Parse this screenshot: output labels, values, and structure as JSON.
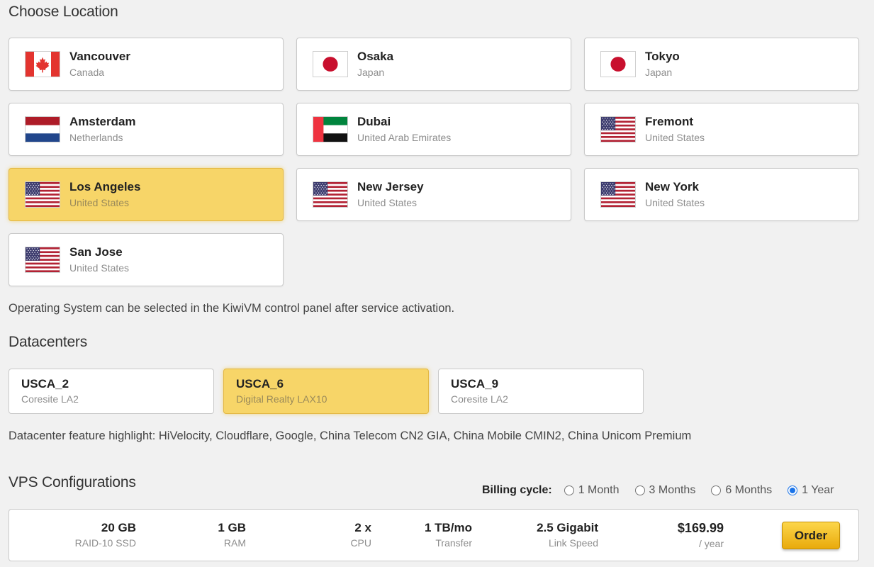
{
  "location": {
    "title": "Choose Location",
    "cards": [
      {
        "city": "Vancouver",
        "country": "Canada",
        "flag": "canada-flag"
      },
      {
        "city": "Osaka",
        "country": "Japan",
        "flag": "japan-flag"
      },
      {
        "city": "Tokyo",
        "country": "Japan",
        "flag": "japan-flag"
      },
      {
        "city": "Amsterdam",
        "country": "Netherlands",
        "flag": "netherlands-flag"
      },
      {
        "city": "Dubai",
        "country": "United Arab Emirates",
        "flag": "uae-flag"
      },
      {
        "city": "Fremont",
        "country": "United States",
        "flag": "us-flag"
      },
      {
        "city": "Los Angeles",
        "country": "United States",
        "flag": "us-flag",
        "selected": true
      },
      {
        "city": "New Jersey",
        "country": "United States",
        "flag": "us-flag"
      },
      {
        "city": "New York",
        "country": "United States",
        "flag": "us-flag"
      },
      {
        "city": "San Jose",
        "country": "United States",
        "flag": "us-flag"
      }
    ],
    "os_note": "Operating System can be selected in the KiwiVM control panel after service activation."
  },
  "datacenters": {
    "title": "Datacenters",
    "cards": [
      {
        "code": "USCA_2",
        "name": "Coresite LA2"
      },
      {
        "code": "USCA_6",
        "name": "Digital Realty LAX10",
        "selected": true
      },
      {
        "code": "USCA_9",
        "name": "Coresite LA2"
      }
    ],
    "feature_note": "Datacenter feature highlight: HiVelocity, Cloudflare, Google, China Telecom CN2 GIA, China Mobile CMIN2, China Unicom Premium"
  },
  "vps": {
    "title": "VPS Configurations",
    "billing": {
      "label": "Billing cycle:",
      "options": [
        "1 Month",
        "3 Months",
        "6 Months",
        "1 Year"
      ],
      "selected": "1 Year"
    },
    "config": {
      "storage": {
        "value": "20 GB",
        "label": "RAID-10 SSD"
      },
      "ram": {
        "value": "1 GB",
        "label": "RAM"
      },
      "cpu": {
        "value": "2 x",
        "label": "CPU"
      },
      "transfer": {
        "value": "1 TB/mo",
        "label": "Transfer"
      },
      "link": {
        "value": "2.5 Gigabit",
        "label": "Link Speed"
      },
      "price": {
        "value": "$169.99",
        "label": "/ year"
      },
      "order_label": "Order"
    }
  },
  "colors": {
    "selected_bg": "#f7d568",
    "selected_border": "#e3b845",
    "order_button": "#f2c12e",
    "radio_checked": "#1a73e8"
  }
}
